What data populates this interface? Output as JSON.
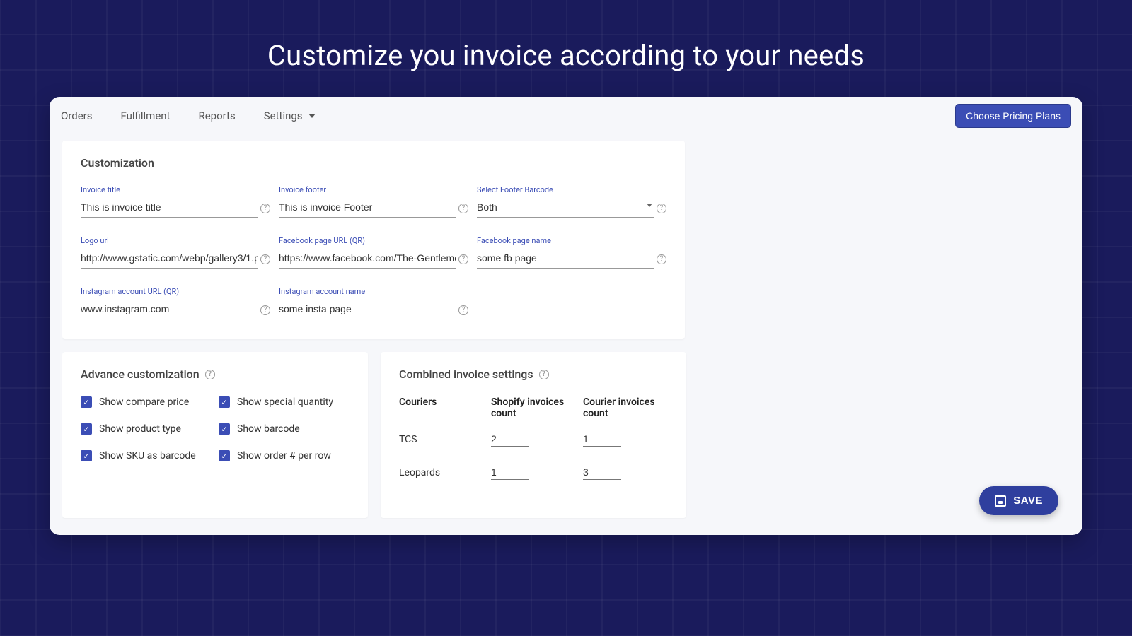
{
  "page_heading": "Customize you invoice according to your needs",
  "nav": {
    "orders": "Orders",
    "fulfillment": "Fulfillment",
    "reports": "Reports",
    "settings": "Settings"
  },
  "pricing_button": "Choose Pricing Plans",
  "customization": {
    "title": "Customization",
    "fields": {
      "invoice_title": {
        "label": "Invoice title",
        "value": "This is invoice title"
      },
      "invoice_footer": {
        "label": "Invoice footer",
        "value": "This is invoice Footer"
      },
      "footer_barcode": {
        "label": "Select Footer Barcode",
        "value": "Both"
      },
      "logo_url": {
        "label": "Logo url",
        "value": "http://www.gstatic.com/webp/gallery3/1.p"
      },
      "fb_url": {
        "label": "Facebook page URL (QR)",
        "value": "https://www.facebook.com/The-Gentleme"
      },
      "fb_name": {
        "label": "Facebook page name",
        "value": "some fb page"
      },
      "insta_url": {
        "label": "Instagram account URL (QR)",
        "value": "www.instagram.com"
      },
      "insta_name": {
        "label": "Instagram account name",
        "value": "some insta page"
      }
    }
  },
  "advance": {
    "title": "Advance customization",
    "checks": {
      "compare_price": "Show compare price",
      "special_quantity": "Show special quantity",
      "product_type": "Show product type",
      "barcode": "Show barcode",
      "sku_barcode": "Show SKU as barcode",
      "order_per_row": "Show order # per row"
    }
  },
  "combined": {
    "title": "Combined invoice settings",
    "headers": {
      "couriers": "Couriers",
      "shopify": "Shopify invoices count",
      "courier": "Courier invoices count"
    },
    "rows": [
      {
        "name": "TCS",
        "shopify": "2",
        "courier": "1"
      },
      {
        "name": "Leopards",
        "shopify": "1",
        "courier": "3"
      }
    ]
  },
  "save_label": "SAVE"
}
